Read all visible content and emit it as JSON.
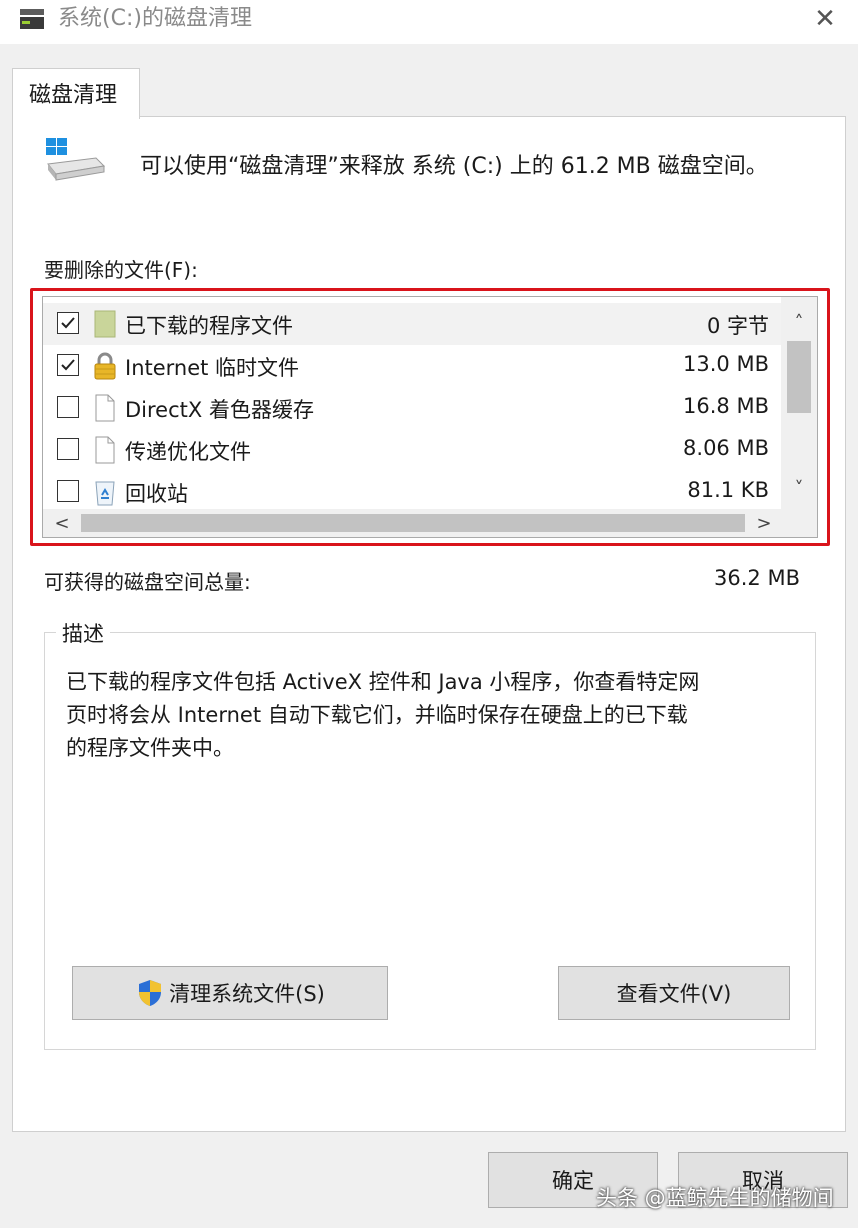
{
  "window": {
    "title": "系统(C:)的磁盘清理",
    "close_glyph": "✕"
  },
  "tab": {
    "label": "磁盘清理"
  },
  "intro_text": "可以使用“磁盘清理”来释放 系统 (C:) 上的 61.2 MB 磁盘空间。",
  "files_label": "要删除的文件(F):",
  "files": [
    {
      "name": "已下载的程序文件",
      "size": "0 字节",
      "checked": true,
      "icon": "folder-icon"
    },
    {
      "name": "Internet 临时文件",
      "size": "13.0 MB",
      "checked": true,
      "icon": "lock-icon"
    },
    {
      "name": "DirectX 着色器缓存",
      "size": "16.8 MB",
      "checked": false,
      "icon": "file-icon"
    },
    {
      "name": "传递优化文件",
      "size": "8.06 MB",
      "checked": false,
      "icon": "file-icon"
    },
    {
      "name": "回收站",
      "size": "81.1 KB",
      "checked": false,
      "icon": "recycle-bin-icon"
    }
  ],
  "scroll": {
    "up": "˄",
    "down": "˅",
    "left": "<",
    "right": ">"
  },
  "total_label": "可获得的磁盘空间总量:",
  "total_value": "36.2 MB",
  "description": {
    "title": "描述",
    "lines": [
      "已下载的程序文件包括 ActiveX 控件和 Java 小程序，你查看特定网",
      "页时将会从 Internet 自动下载它们，并临时保存在硬盘上的已下载",
      "的程序文件夹中。"
    ]
  },
  "buttons": {
    "clean_system": "清理系统文件(S)",
    "view_files": "查看文件(V)",
    "ok": "确定",
    "cancel": "取消"
  },
  "watermark": "头条 @蓝鲸先生的储物间",
  "colors": {
    "highlight": "#d9141b",
    "button_bg": "#e1e1e1"
  }
}
